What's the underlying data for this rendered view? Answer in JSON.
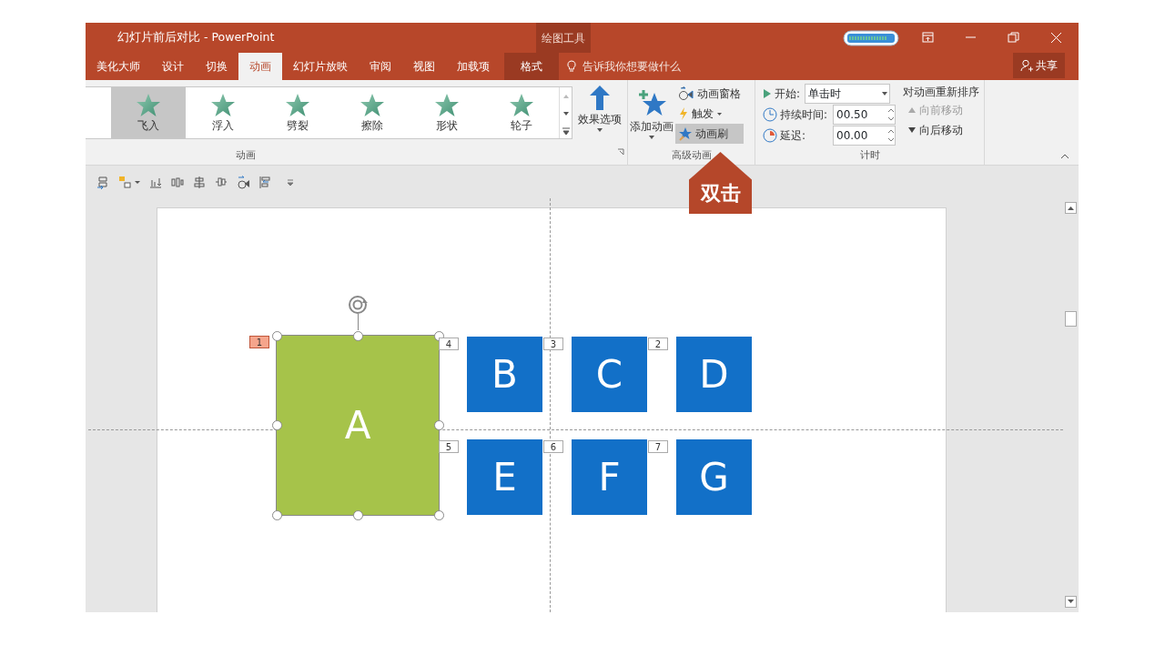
{
  "window": {
    "title": "幻灯片前后对比 - PowerPoint",
    "context_group": "绘图工具"
  },
  "tabs": [
    {
      "label": "美化大师",
      "selected": false,
      "kind": "normal"
    },
    {
      "label": "设计",
      "selected": false,
      "kind": "normal"
    },
    {
      "label": "切换",
      "selected": false,
      "kind": "normal"
    },
    {
      "label": "动画",
      "selected": true,
      "kind": "normal"
    },
    {
      "label": "幻灯片放映",
      "selected": false,
      "kind": "normal"
    },
    {
      "label": "审阅",
      "selected": false,
      "kind": "normal"
    },
    {
      "label": "视图",
      "selected": false,
      "kind": "normal"
    },
    {
      "label": "加载项",
      "selected": false,
      "kind": "normal"
    },
    {
      "label": "格式",
      "selected": false,
      "kind": "context"
    }
  ],
  "tell_me": {
    "placeholder": "告诉我你想要做什么"
  },
  "share_button": "共享",
  "ribbon": {
    "animations": {
      "items": [
        {
          "label": "飞入",
          "selected": true
        },
        {
          "label": "浮入",
          "selected": false
        },
        {
          "label": "劈裂",
          "selected": false
        },
        {
          "label": "擦除",
          "selected": false
        },
        {
          "label": "形状",
          "selected": false
        },
        {
          "label": "轮子",
          "selected": false
        }
      ],
      "effect_options": "效果选项",
      "group_label": "动画"
    },
    "advanced": {
      "add_animation": "添加动画",
      "animation_pane": "动画窗格",
      "trigger": "触发",
      "painter": {
        "label": "动画刷",
        "selected": true
      },
      "group_label": "高级动画"
    },
    "timing": {
      "start_label": "开始:",
      "start_value": "单击时",
      "duration_label": "持续时间:",
      "duration_value": "00.50",
      "delay_label": "延迟:",
      "delay_value": "00.00",
      "reorder_title": "对动画重新排序",
      "move_earlier": {
        "label": "向前移动",
        "disabled": true
      },
      "move_later": {
        "label": "向后移动",
        "disabled": false
      },
      "group_label": "计时"
    }
  },
  "callout": "双击",
  "slide": {
    "shapes": [
      {
        "label": "A",
        "color": "#a6c34a",
        "selected": true,
        "order_tag": "1"
      },
      {
        "label": "B",
        "color": "#1270c8",
        "selected": false,
        "order_tag": "4"
      },
      {
        "label": "C",
        "color": "#1270c8",
        "selected": false,
        "order_tag": "3"
      },
      {
        "label": "D",
        "color": "#1270c8",
        "selected": false,
        "order_tag": "2"
      },
      {
        "label": "E",
        "color": "#1270c8",
        "selected": false,
        "order_tag": "5"
      },
      {
        "label": "F",
        "color": "#1270c8",
        "selected": false,
        "order_tag": "6"
      },
      {
        "label": "G",
        "color": "#1270c8",
        "selected": false,
        "order_tag": "7"
      }
    ]
  }
}
